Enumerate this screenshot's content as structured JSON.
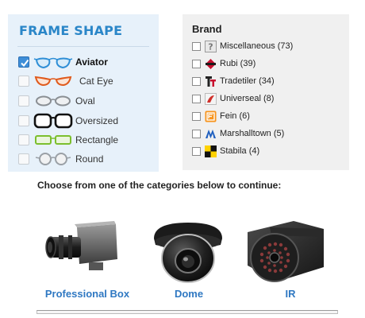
{
  "frame_shape": {
    "title": "FRAME SHAPE",
    "items": [
      {
        "label": "Aviator",
        "checked": true,
        "color": "#2f8fd6",
        "icon": "aviator-glasses-icon"
      },
      {
        "label": "Cat Eye",
        "checked": false,
        "color": "#e05a1c",
        "icon": "cat-eye-glasses-icon"
      },
      {
        "label": "Oval",
        "checked": false,
        "color": "#8a8f94",
        "icon": "oval-glasses-icon"
      },
      {
        "label": "Oversized",
        "checked": false,
        "color": "#111111",
        "icon": "oversized-glasses-icon"
      },
      {
        "label": "Rectangle",
        "checked": false,
        "color": "#7cbf2e",
        "icon": "rectangle-glasses-icon"
      },
      {
        "label": "Round",
        "checked": false,
        "color": "#9aa0a6",
        "icon": "round-glasses-icon"
      }
    ]
  },
  "brand": {
    "title": "Brand",
    "items": [
      {
        "label": "Miscellaneous (73)",
        "icon": "question-mark-icon"
      },
      {
        "label": "Rubi (39)",
        "icon": "rubi-logo-icon"
      },
      {
        "label": "Tradetiler (34)",
        "icon": "tradetiler-logo-icon"
      },
      {
        "label": "Universeal (8)",
        "icon": "universeal-logo-icon"
      },
      {
        "label": "Fein (6)",
        "icon": "fein-logo-icon"
      },
      {
        "label": "Marshalltown (5)",
        "icon": "marshalltown-logo-icon"
      },
      {
        "label": "Stabila (4)",
        "icon": "stabila-logo-icon"
      }
    ]
  },
  "categories": {
    "prompt": "Choose from one of the categories below to continue:",
    "items": [
      {
        "label": "Professional Box",
        "icon": "box-camera-icon"
      },
      {
        "label": "Dome",
        "icon": "dome-camera-icon"
      },
      {
        "label": "IR",
        "icon": "ir-camera-icon"
      }
    ]
  },
  "colors": {
    "frame_title": "#2a86c8",
    "frame_panel_bg": "#e7f1fa",
    "brand_panel_bg": "#f0f0f0",
    "category_link": "#2f78c2",
    "checkbox_checked": "#3e8ed8"
  }
}
